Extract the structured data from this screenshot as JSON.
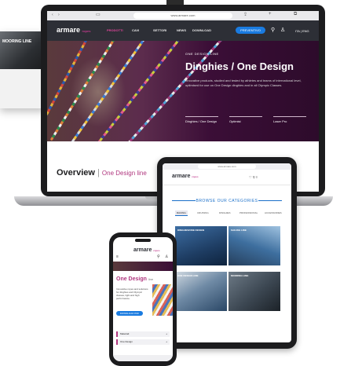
{
  "bg_card": {
    "label": "MOORING LINE"
  },
  "laptop": {
    "url": "www.armare.com",
    "logo": "armare",
    "logo_sub": "ropes",
    "nav": [
      "PRODOTTI",
      "CAVI",
      "SETTORI",
      "NEWS",
      "DOWNLOAD"
    ],
    "nav_button": "PREVENTIVO",
    "lang": "ITA | ENG",
    "hero_tag": "ONE DESIGN LINE",
    "hero_title": "Dinghies / One Design",
    "hero_text": "Innovative products, studied and tested by athletes and teams of international level, optimised for use on One Design dinghies and in all Olympic Classes.",
    "sub_cols": [
      "Dinghies / One Design",
      "Optimist",
      "Laser Pro"
    ],
    "overview_title": "Overview",
    "overview_sep": "|",
    "overview_link": "One Design line"
  },
  "tablet": {
    "url": "www.armare.com",
    "logo": "armare",
    "logo_sub": "ropes",
    "icons": "♡ ⚲ ≡",
    "categories_title": "BROWSE OUR CATEGORIES",
    "tabs": [
      "RACING",
      "CRUISING",
      "DINGHIES",
      "PROFESSIONAL",
      "ACCESSORIES"
    ],
    "cards": [
      "DINGHIES/ONE DESIGN",
      "SAILING LINE",
      "ONE DESIGN LINE",
      "MOORING LINE"
    ]
  },
  "phone": {
    "logo": "armare",
    "logo_sub": "ropes",
    "title": "One Design",
    "title_light": "line",
    "text": "Innovative ropes and solutions for dinghies and Olympic classes, light and high performance.",
    "button": "DOWNLOAD PDF",
    "rows": [
      "Materiali",
      "One Design"
    ]
  },
  "colors": {
    "accent": "#b0377f",
    "blue": "#1a7be0",
    "dark": "#2d2f36"
  }
}
